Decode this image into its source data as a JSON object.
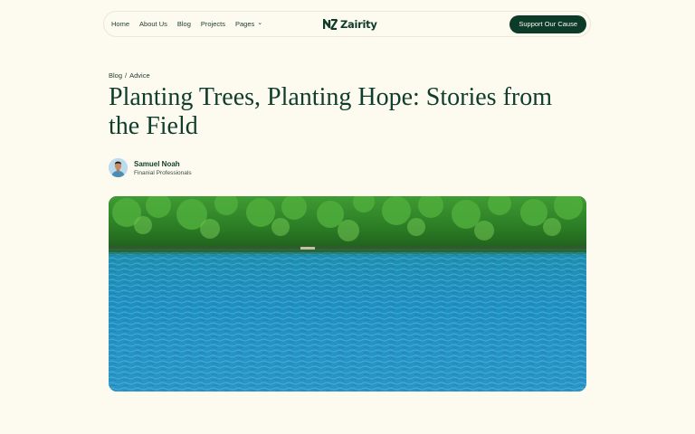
{
  "nav": {
    "links": [
      {
        "label": "Home"
      },
      {
        "label": "About Us"
      },
      {
        "label": "Blog"
      },
      {
        "label": "Projects"
      },
      {
        "label": "Pages"
      }
    ],
    "logo_text": "Zairity",
    "cta_label": "Support Our Cause"
  },
  "breadcrumb": {
    "section": "Blog",
    "separator": "/",
    "category": "Advice"
  },
  "article": {
    "title": "Planting Trees, Planting Hope: Stories from the Field",
    "author_name": "Samuel Noah",
    "author_role": "Finanial Professionals"
  },
  "colors": {
    "background": "#fdfaef",
    "brand_dark_green": "#0d3b2a",
    "lake_blue": "#1e8fbf",
    "forest_green": "#2f7d2a"
  },
  "icons": [
    "logo-mark-icon",
    "chevron-down-icon"
  ]
}
